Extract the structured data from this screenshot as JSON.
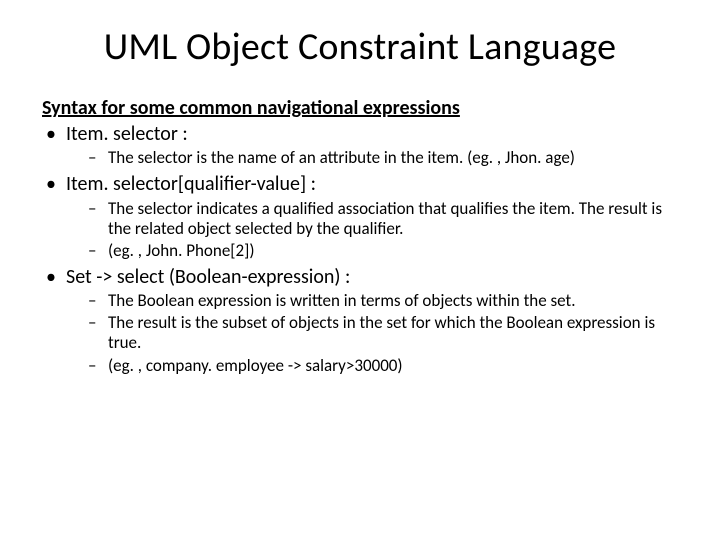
{
  "title": "UML Object Constraint Language",
  "subhead": "Syntax for some common navigational expressions",
  "items": [
    {
      "text": "Item. selector :",
      "sub": [
        "The selector is the name of an attribute in the item. (eg. , Jhon. age)"
      ]
    },
    {
      "text": "Item. selector[qualifier-value] :",
      "sub": [
        "The selector indicates a qualified association that qualifies the item. The result is the related object selected by the qualifier.",
        "(eg. , John. Phone[2])"
      ]
    },
    {
      "text": "Set -> select (Boolean-expression) :",
      "sub": [
        "The Boolean expression is written in terms of objects within the set.",
        "The result is the subset of objects in the set for which the Boolean expression is true.",
        "(eg. , company. employee -> salary>30000)"
      ]
    }
  ]
}
